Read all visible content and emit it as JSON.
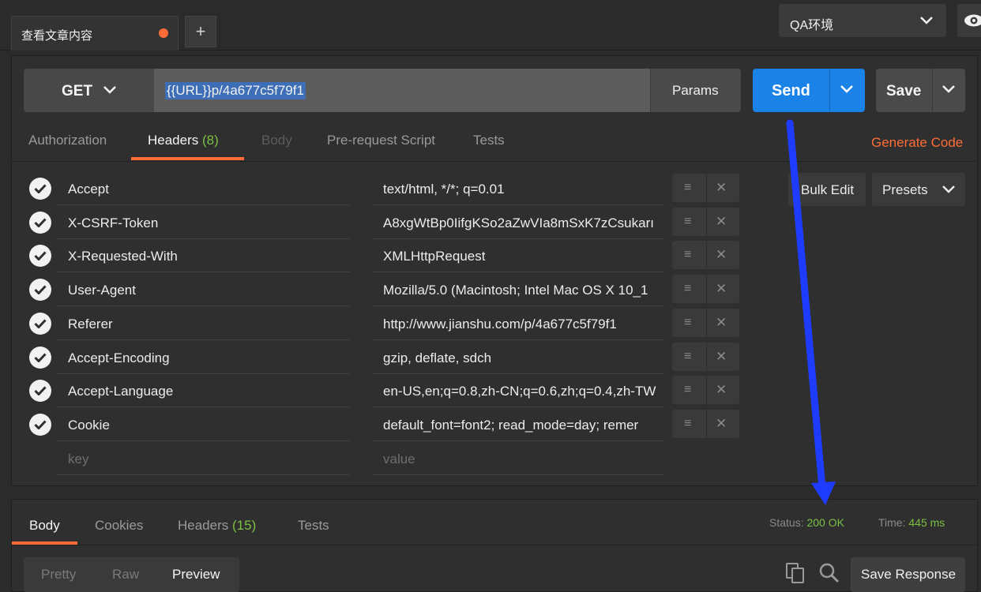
{
  "tabs": {
    "request_tab": "查看文章内容",
    "new_tab": "+"
  },
  "environment": {
    "selected": "QA环境"
  },
  "request": {
    "method": "GET",
    "url": "{{URL}}p/4a677c5f79f1",
    "params_label": "Params",
    "send_label": "Send",
    "save_label": "Save"
  },
  "request_tabs": [
    {
      "label": "Authorization"
    },
    {
      "label": "Headers",
      "count": "(8)"
    },
    {
      "label": "Body"
    },
    {
      "label": "Pre-request Script"
    },
    {
      "label": "Tests"
    }
  ],
  "generate_code": "Generate Code",
  "bulk_edit": "Bulk Edit",
  "presets": "Presets",
  "headers": [
    {
      "key": "Accept",
      "value": "text/html, */*; q=0.01"
    },
    {
      "key": "X-CSRF-Token",
      "value": "A8xgWtBp0IifgKSo2aZwVIa8mSxK7zCsukarı"
    },
    {
      "key": "X-Requested-With",
      "value": "XMLHttpRequest"
    },
    {
      "key": "User-Agent",
      "value": "Mozilla/5.0 (Macintosh; Intel Mac OS X 10_1"
    },
    {
      "key": "Referer",
      "value": "http://www.jianshu.com/p/4a677c5f79f1"
    },
    {
      "key": "Accept-Encoding",
      "value": "gzip, deflate, sdch"
    },
    {
      "key": "Accept-Language",
      "value": "en-US,en;q=0.8,zh-CN;q=0.6,zh;q=0.4,zh-TW"
    },
    {
      "key": "Cookie",
      "value": "default_font=font2; read_mode=day; remer"
    }
  ],
  "header_placeholder": {
    "key": "key",
    "value": "value"
  },
  "row_icons": {
    "handle": "≡",
    "remove": "✕"
  },
  "response_tabs": [
    {
      "label": "Body"
    },
    {
      "label": "Cookies"
    },
    {
      "label": "Headers",
      "count": "(15)"
    },
    {
      "label": "Tests"
    }
  ],
  "status": {
    "label": "Status:",
    "value": "200 OK",
    "time_label": "Time:",
    "time_value": "445 ms"
  },
  "view_modes": [
    "Pretty",
    "Raw",
    "Preview"
  ],
  "save_response": "Save Response",
  "colors": {
    "accent": "#ff6c37",
    "send": "#1b82e8",
    "success": "#7bc043",
    "annotation_arrow": "#1e3cff"
  }
}
